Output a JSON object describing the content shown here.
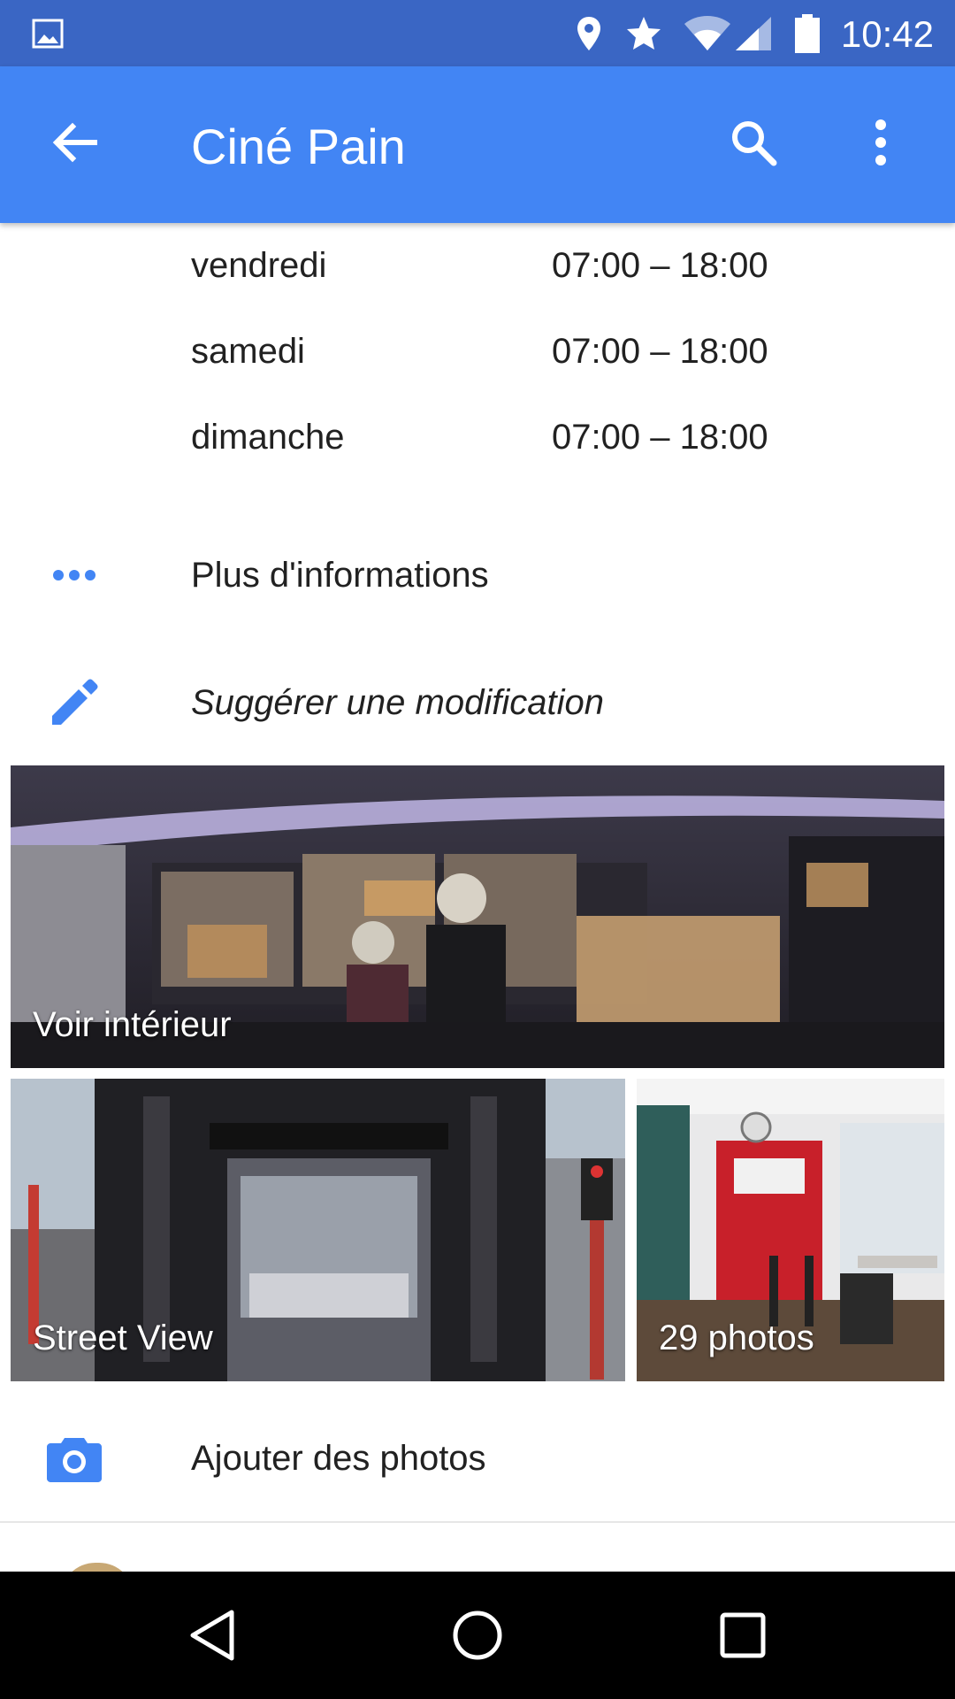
{
  "status_bar": {
    "time": "10:42",
    "icons": [
      "image-icon",
      "location-pin-icon",
      "star-icon",
      "wifi-icon",
      "cell-signal-icon",
      "battery-icon"
    ]
  },
  "app_bar": {
    "title": "Ciné Pain",
    "icons": [
      "back-arrow-icon",
      "search-icon",
      "more-vert-icon"
    ],
    "color": "#4285f4"
  },
  "hours": [
    {
      "day": "vendredi",
      "range": "07:00 – 18:00"
    },
    {
      "day": "samedi",
      "range": "07:00 – 18:00"
    },
    {
      "day": "dimanche",
      "range": "07:00 – 18:00"
    }
  ],
  "actions": {
    "more_info": {
      "label": "Plus d'informations",
      "icon": "more-horiz-icon"
    },
    "suggest_edit": {
      "label": "Suggérer une modification",
      "icon": "pencil-icon"
    },
    "add_photos": {
      "label": "Ajouter des photos",
      "icon": "camera-icon"
    }
  },
  "photos": {
    "interior": {
      "caption": "Voir intérieur"
    },
    "street_view": {
      "caption": "Street View"
    },
    "gallery": {
      "caption": "29 photos"
    }
  },
  "nav_bar": {
    "icons": [
      "back-triangle-icon",
      "home-circle-icon",
      "recents-square-icon"
    ]
  },
  "accent_color": "#4285f4"
}
